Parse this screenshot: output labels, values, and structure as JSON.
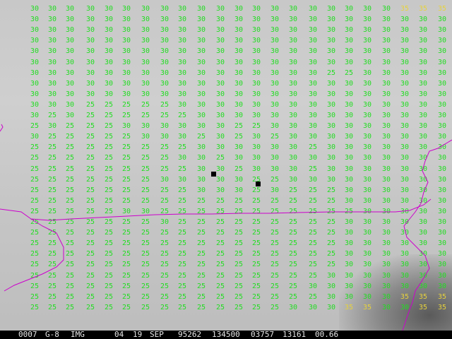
{
  "status": {
    "frame": "0007",
    "satellite": "G-8",
    "product": "IMG",
    "band": "04",
    "day": "19",
    "month": "SEP",
    "julian": "95262",
    "time": "134500",
    "line": "03757",
    "element": "13161",
    "res": "00.66"
  },
  "colors": {
    "normal": "#22dd22",
    "warm": "#e6d23c",
    "coast": "#cc00cc",
    "marker": "#000000"
  },
  "rows": [
    "30 30 30 30 30 30 30 30 30 30 30 30 30 30 30 30 30 30 30 30 35 35 35",
    "30 30 30 30 30 30 30 30 30 30 30 30 30 30 30 30 30 30 30 30 30 30 30",
    "30 30 30 30 30 30 30 30 30 30 30 30 30 30 30 30 30 30 30 30 30 30 30",
    "30 30 30 30 30 30 30 30 30 30 30 30 30 30 30 30 30 30 30 30 30 30 30",
    "30 30 30 30 30 30 30 30 30 30 30 30 30 30 30 30 30 30 30 30 30 30 30",
    "30 30 30 30 30 30 30 30 30 30 30 30 30 30 30 30 30 30 30 30 30 30 30",
    "30 30 30 30 30 30 30 30 30 30 30 30 30 30 30 30 25 25 30 30 30 30 30",
    "30 30 30 30 30 30 30 30 30 30 30 30 30 30 30 30 30 30 30 30 30 30 30",
    "30 30 30 30 30 30 30 30 30 30 30 30 30 30 30 30 30 30 30 30 30 30 30",
    "30 30 30 25 25 25 25 25 30 30 30 30 30 30 30 30 30 30 30 30 30 30 30",
    "30 25 30 25 25 25 25 25 25 30 30 30 30 30 30 30 30 30 30 30 30 30 30",
    "25 30 25 25 25 30 30 30 30 30 30 25 25 30 30 30 30 30 30 30 30 30 30",
    "30 25 25 25 25 25 30 30 30 25 30 25 30 25 30 30 30 30 30 30 30 30 30",
    "25 25 25 25 25 25 25 25 25 30 30 30 30 30 30 25 30 30 30 30 30 30 30",
    "25 25 25 25 25 25 25 25 30 30 25 30 30 30 30 30 30 30 30 30 30 30 30",
    "25 25 25 25 25 25 25 25 25 30 30 25 30 30 30 25 30 30 30 30 30 30 30",
    "25 25 25 25 25 25 25 30 30 30 30 30 25 25 30 30 30 30 30 30 30 30 30",
    "25 25 25 25 25 25 25 25 25 30 30 30 25 30 25 25 25 30 30 30 30 30 30",
    "25 25 25 25 25 25 25 25 25 25 25 25 25 25 25 25 25 30 30 30 30 30 30",
    "25 25 25 25 25 30 30 25 25 25 25 25 25 25 25 25 25 25 30 30 30 30 30",
    "25 25 25 25 25 25 25 30 25 25 25 25 25 25 25 25 25 30 30 30 30 30 30",
    "25 25 25 25 25 25 25 25 25 25 25 25 25 25 25 25 25 30 30 30 30 30 30",
    "25 25 25 25 25 25 25 25 25 25 25 25 25 25 25 25 25 30 30 30 30 30 30",
    "25 25 25 25 25 25 25 25 25 25 25 25 25 25 25 25 25 30 30 30 30 30 30",
    "25 25 25 25 25 25 25 25 25 25 25 25 25 25 25 25 25 30 30 30 30 30 30",
    "25 25 25 25 25 25 25 25 25 25 25 25 25 25 25 25 30 30 30 30 30 30 30",
    "25 25 25 25 25 25 25 25 25 25 25 25 25 25 25 30 30 30 30 30 30 30 30",
    "25 25 25 25 25 25 25 25 25 25 25 25 25 25 25 25 30 30 30 30 35 35 35",
    "25 25 25 25 25 25 25 25 25 25 25 25 25 25 30 30 30 35 35 30 30 35 35"
  ]
}
